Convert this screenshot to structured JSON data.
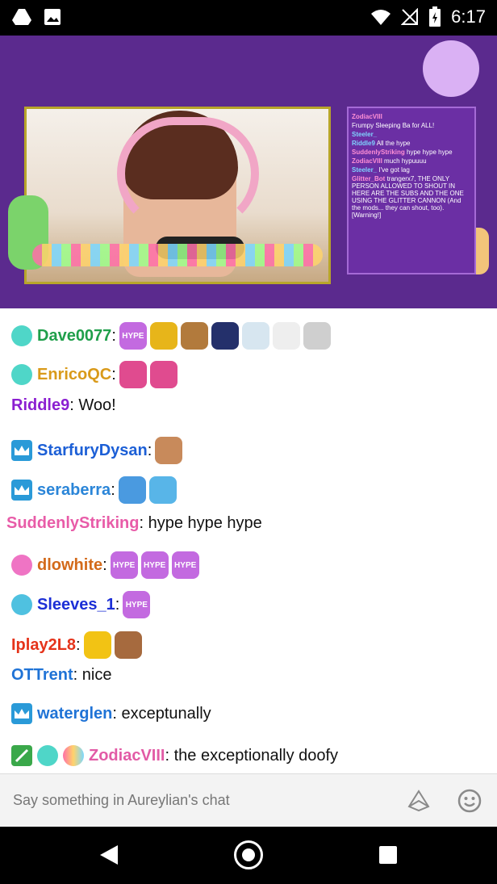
{
  "status_bar": {
    "time": "6:17",
    "icons": [
      "drive-icon",
      "image-icon",
      "wifi-icon",
      "no-signal-icon",
      "battery-charging-icon"
    ]
  },
  "stream_overlay": {
    "chat_lines": [
      {
        "user": "ZodiacVIII",
        "text": ""
      },
      {
        "user": "",
        "text": "Frumpy Sleeping Ba for ALL!"
      },
      {
        "user": "Steeler_",
        "text": ""
      },
      {
        "user": "Riddle9",
        "text": "All the hype"
      },
      {
        "user": "SuddenlyStriking",
        "text": "hype hype hype"
      },
      {
        "user": "ZodiacVIII",
        "text": "much hypuuuu"
      },
      {
        "user": "Steeler_",
        "text": "I've got lag"
      },
      {
        "user": "Glitter_Bot",
        "text": "trangerx7, THE ONLY PERSON ALLOWED TO SHOUT IN HERE ARE THE SUBS AND THE ONE USING THE GLITTER CANNON (And the mods... they can shout, too). [Warning!]"
      }
    ]
  },
  "chat": {
    "messages": [
      {
        "user": "Dave0077",
        "color": "#1f9f4a",
        "badges": [
          "heart-badge-icon"
        ],
        "text": "",
        "emotes": [
          "hype-emote-icon",
          "trophy-emote-icon",
          "bear-emote-icon",
          "cat-emote-icon",
          "cat-glasses-emote-icon",
          "dog-emote-icon",
          "dog2-emote-icon"
        ]
      },
      {
        "user": "EnricoQC",
        "color": "#d99a1a",
        "badges": [
          "heart-badge-icon"
        ],
        "text": "",
        "emotes": [
          "heart-emote-icon",
          "heart-emote-icon"
        ]
      },
      {
        "user": "Riddle9",
        "color": "#8b1fd1",
        "badges": [],
        "text": ": Woo!",
        "emotes": []
      },
      {
        "user": "StarfuryDysan",
        "color": "#1c5fd6",
        "badges": [
          "crown-badge-icon"
        ],
        "text": "",
        "emotes": [
          "face-emote-icon"
        ]
      },
      {
        "user": "seraberra",
        "color": "#2a85d8",
        "badges": [
          "crown-badge-icon"
        ],
        "text": "",
        "emotes": [
          "arm-emote-icon",
          "hype-cat-emote-icon"
        ]
      },
      {
        "user": "SuddenlyStriking",
        "color": "#e85ca8",
        "badges": [],
        "text": ": hype hype hype",
        "emotes": []
      },
      {
        "user": "dlowhite",
        "color": "#d36a1a",
        "badges": [
          "heart-badge-icon"
        ],
        "text": "",
        "emotes": [
          "hype-emote-icon",
          "hype-emote-icon",
          "hype-emote-icon"
        ]
      },
      {
        "user": "Sleeves_1",
        "color": "#1c2fd6",
        "badges": [
          "heart-badge-icon"
        ],
        "text": "",
        "emotes": [
          "hype-emote-icon"
        ]
      },
      {
        "user": "Iplay2L8",
        "color": "#e5331a",
        "badges": [],
        "text": "",
        "emotes": [
          "kapow-emote-icon",
          "fist-emote-icon"
        ]
      },
      {
        "user": "OTTrent",
        "color": "#1f73d6",
        "badges": [],
        "text": ": nice",
        "emotes": []
      },
      {
        "user": "waterglen",
        "color": "#1f73d6",
        "badges": [
          "crown-badge-icon"
        ],
        "text": ": exceptunally",
        "emotes": []
      },
      {
        "user": "ZodiacVIII",
        "color": "#e25ba6",
        "badges": [
          "sword-badge-icon",
          "heart-badge-icon",
          "rainbow-badge-icon"
        ],
        "text": ": the exceptionally doofy",
        "emotes": []
      }
    ],
    "emote_label": "HYPE"
  },
  "input": {
    "placeholder": "Say something in Aureylian's chat"
  }
}
